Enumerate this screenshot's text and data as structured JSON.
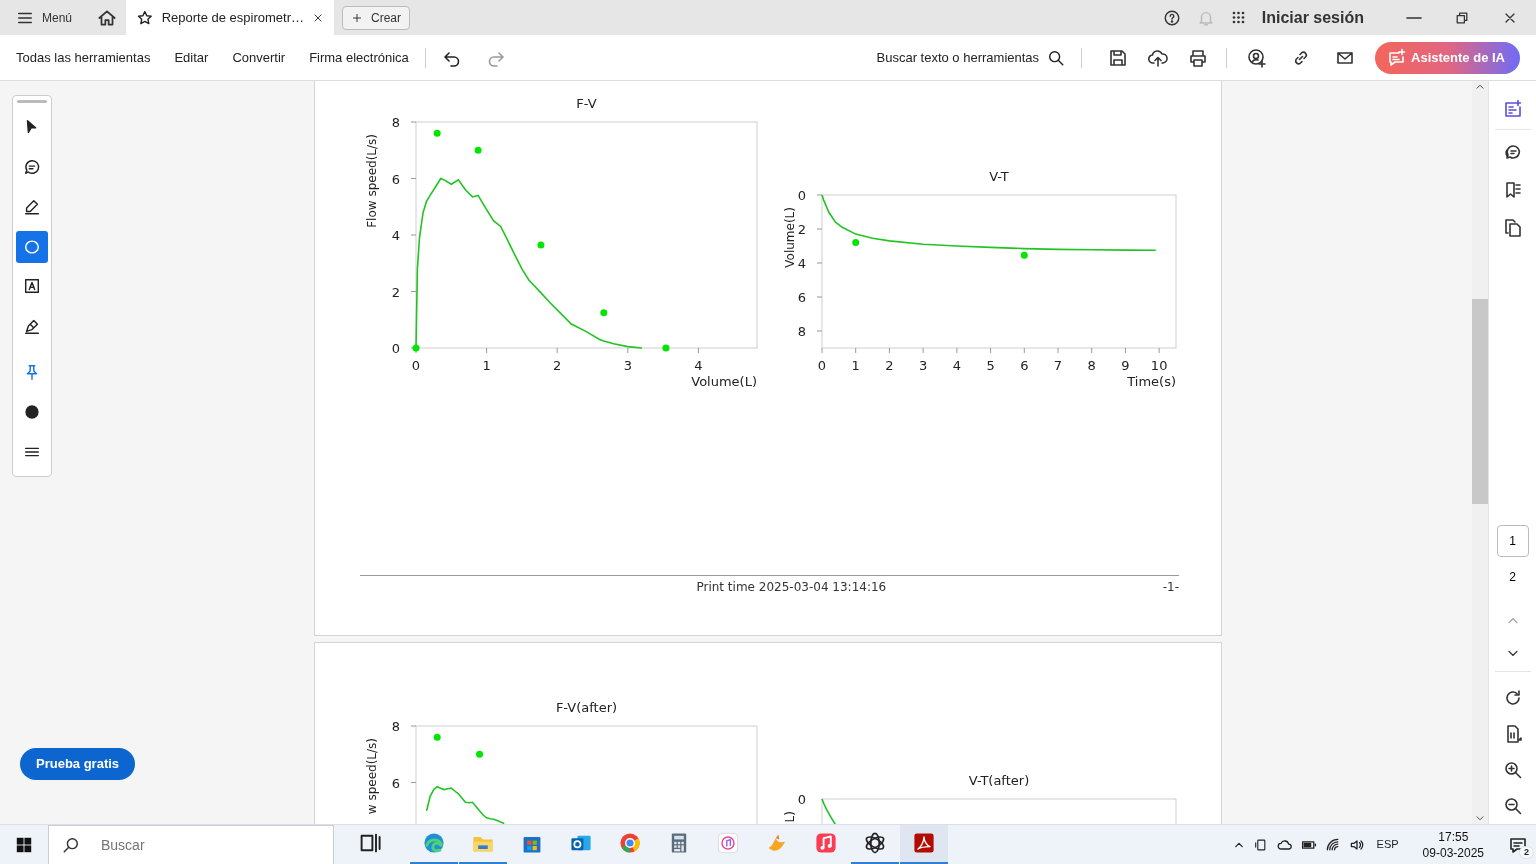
{
  "tab_bar": {
    "menu_label": "Menú",
    "tabs": [
      {
        "title": "Reporte de espirometr…",
        "selected": true
      }
    ],
    "create_label": "Crear",
    "sign_in": "Iniciar sesión"
  },
  "toolbar": {
    "menus": [
      "Todas las herramientas",
      "Editar",
      "Convertir",
      "Firma electrónica"
    ],
    "undo_enabled": true,
    "redo_enabled": false,
    "search_label": "Buscar texto o herramientas",
    "ai_button": "Asistente de IA"
  },
  "tools": [
    {
      "kind": "select",
      "selected": false
    },
    {
      "kind": "comment",
      "selected": false
    },
    {
      "kind": "highlight",
      "selected": false
    },
    {
      "kind": "ellipse",
      "selected": true
    },
    {
      "kind": "textbox",
      "selected": false
    },
    {
      "kind": "sign",
      "selected": false
    },
    {
      "kind": "pin",
      "selected": false
    },
    {
      "kind": "color",
      "selected": false
    },
    {
      "kind": "more",
      "selected": false
    }
  ],
  "trial_button": "Prueba gratis",
  "pages": [
    {
      "charts": [
        {
          "title": "F-V",
          "chart_data": {
            "type": "line",
            "xlabel": "Volume(L)",
            "ylabel": "Flow speed(L/s)",
            "xlim": [
              0,
              4.83
            ],
            "ylim": [
              0,
              8
            ],
            "xticks": [
              0,
              1,
              2,
              3,
              4
            ],
            "yticks": [
              0,
              2,
              4,
              6,
              8
            ],
            "x": [
              0,
              0.02,
              0.05,
              0.1,
              0.15,
              0.2,
              0.3,
              0.35,
              0.4,
              0.5,
              0.6,
              0.7,
              0.8,
              0.88,
              1.0,
              1.1,
              1.2,
              1.3,
              1.4,
              1.5,
              1.6,
              1.77,
              1.9,
              2.0,
              2.2,
              2.4,
              2.6,
              2.66,
              2.8,
              3.0,
              3.2,
              3.54
            ],
            "series": [
              {
                "type": "line",
                "color": "#22c322",
                "values": [
                  0,
                  2.8,
                  3.9,
                  4.8,
                  5.2,
                  5.4,
                  5.8,
                  6.0,
                  5.95,
                  5.8,
                  5.95,
                  5.6,
                  5.35,
                  5.4,
                  4.9,
                  4.5,
                  4.3,
                  3.8,
                  3.3,
                  2.8,
                  2.4,
                  1.95,
                  1.6,
                  1.35,
                  0.85,
                  0.6,
                  0.3,
                  0.25,
                  0.15,
                  0.05,
                  0,
                  null
                ]
              },
              {
                "type": "scatter",
                "color": "#00e600",
                "values": [
                  0,
                  null,
                  null,
                  null,
                  null,
                  null,
                  7.6,
                  null,
                  null,
                  null,
                  null,
                  null,
                  null,
                  7.0,
                  null,
                  null,
                  null,
                  null,
                  null,
                  null,
                  null,
                  3.65,
                  null,
                  null,
                  null,
                  null,
                  null,
                  1.25,
                  null,
                  null,
                  null,
                  0
                ]
              }
            ]
          }
        },
        {
          "title": "V-T",
          "chart_data": {
            "type": "line",
            "xlabel": "Time(s)",
            "ylabel": "Volume(L)",
            "xlim": [
              0,
              10.5
            ],
            "ylim": [
              9,
              0
            ],
            "xticks": [
              0,
              1,
              2,
              3,
              4,
              5,
              6,
              7,
              8,
              9,
              10
            ],
            "yticks": [
              0,
              2,
              4,
              6,
              8
            ],
            "x": [
              0,
              0.05,
              0.2,
              0.4,
              0.6,
              1,
              1.5,
              2,
              3,
              4,
              5,
              6,
              7,
              8,
              9,
              9.9
            ],
            "series": [
              {
                "type": "line",
                "color": "#22c322",
                "values": [
                  0,
                  0.3,
                  1.0,
                  1.6,
                  1.9,
                  2.3,
                  2.55,
                  2.7,
                  2.9,
                  3.0,
                  3.08,
                  3.15,
                  3.2,
                  3.22,
                  3.24,
                  3.25
                ]
              },
              {
                "type": "scatter",
                "color": "#00e600",
                "values": [
                  null,
                  null,
                  null,
                  null,
                  null,
                  2.8,
                  null,
                  null,
                  null,
                  null,
                  null,
                  3.55,
                  null,
                  null,
                  null,
                  null
                ]
              }
            ]
          }
        }
      ],
      "footer": {
        "print_time": "Print time 2025-03-04 13:14:16",
        "page_number": "-1-"
      }
    },
    {
      "charts": [
        {
          "title": "F-V(after)",
          "chart_data": {
            "type": "line",
            "ylabel": "w speed(L/s)",
            "ylim": [
              0,
              8
            ],
            "yticks": [
              6,
              8
            ],
            "categories": [
              null,
              null,
              null,
              null,
              null,
              null,
              null,
              null,
              null,
              null,
              null,
              null,
              null,
              null,
              null,
              null,
              null,
              null,
              null,
              null,
              null,
              null,
              null,
              null
            ],
            "series": [
              {
                "type": "line",
                "color": "#22c322",
                "values": [
                  null,
                  5.0,
                  5.5,
                  5.75,
                  5.85,
                  5.8,
                  5.75,
                  5.78,
                  5.8,
                  5.7,
                  5.6,
                  5.45,
                  5.3,
                  5.28,
                  5.3,
                  5.15,
                  5.0,
                  4.85,
                  4.75,
                  4.72,
                  4.7,
                  4.65,
                  4.6,
                  4.55
                ]
              },
              {
                "type": "scatter",
                "color": "#00e600",
                "values": [
                  null,
                  null,
                  null,
                  null,
                  7.6,
                  null,
                  null,
                  null,
                  null,
                  null,
                  null,
                  null,
                  null,
                  null,
                  null,
                  null,
                  7.0,
                  null,
                  null,
                  null,
                  null,
                  null,
                  null,
                  null
                ]
              }
            ]
          }
        },
        {
          "title": "V-T(after)",
          "chart_data": {
            "type": "other",
            "ylabel": "L)",
            "annotations": [
              {
                "text": "0"
              }
            ]
          }
        }
      ]
    }
  ],
  "page_nav": {
    "pages": [
      {
        "label": "1",
        "selected": true
      },
      {
        "label": "2",
        "selected": false
      }
    ]
  },
  "taskbar": {
    "search_placeholder": "Buscar",
    "apps": [
      {
        "kind": "taskview",
        "running": false,
        "active": false
      },
      {
        "kind": "wave",
        "running": true,
        "active": false
      },
      {
        "kind": "folder",
        "running": true,
        "active": false
      },
      {
        "kind": "bag",
        "running": false,
        "active": false
      },
      {
        "kind": "mail",
        "running": false,
        "active": false
      },
      {
        "kind": "ring",
        "running": false,
        "active": false
      },
      {
        "kind": "calculator",
        "running": false,
        "active": false
      },
      {
        "kind": "note",
        "running": false,
        "active": false
      },
      {
        "kind": "bird",
        "running": false,
        "active": false
      },
      {
        "kind": "music",
        "running": false,
        "active": false
      },
      {
        "kind": "knot",
        "running": true,
        "active": false
      },
      {
        "kind": "document",
        "running": true,
        "active": true
      }
    ],
    "language": "ESP",
    "time": "17:55",
    "date": "09-03-2025",
    "notifications": "2"
  }
}
